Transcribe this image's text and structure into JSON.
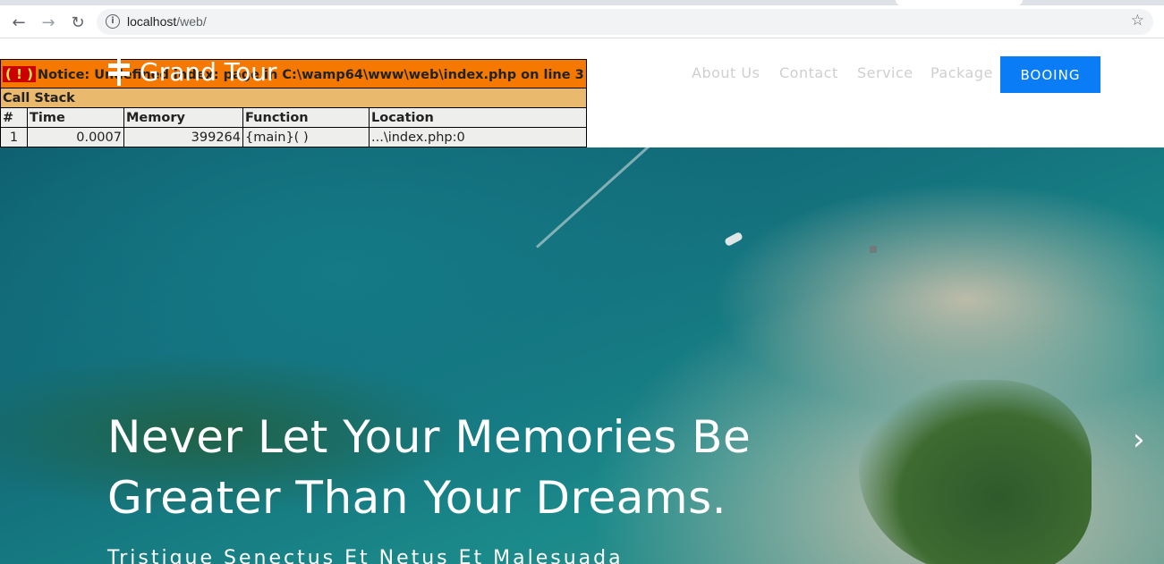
{
  "browser": {
    "url_host": "localhost",
    "url_path": "/web/",
    "back_icon": "back-arrow-icon",
    "forward_icon": "forward-arrow-icon",
    "reload_icon": "reload-icon",
    "info_icon": "info-icon",
    "bookmark_icon": "star-icon"
  },
  "php_error": {
    "icon_text": "( ! )",
    "message": "Notice: Undefined index: page in C:\\wamp64\\www\\web\\index.php on line 3",
    "call_stack_label": "Call Stack",
    "columns": [
      "#",
      "Time",
      "Memory",
      "Function",
      "Location"
    ],
    "rows": [
      {
        "num": "1",
        "time": "0.0007",
        "memory": "399264",
        "function": "{main}( )",
        "location": "...\\index.php:0"
      }
    ]
  },
  "site": {
    "brand": "Grand Tour",
    "nav": [
      "About Us",
      "Contact",
      "Service",
      "Package"
    ],
    "cta": "BOOING",
    "accent_color": "#0a7cf5"
  },
  "hero": {
    "headline_line1": "Never Let Your Memories Be",
    "headline_line2": "Greater Than Your Dreams.",
    "subline": "Tristique Senectus Et Netus Et Malesuada",
    "next_icon": "chevron-right-icon"
  }
}
